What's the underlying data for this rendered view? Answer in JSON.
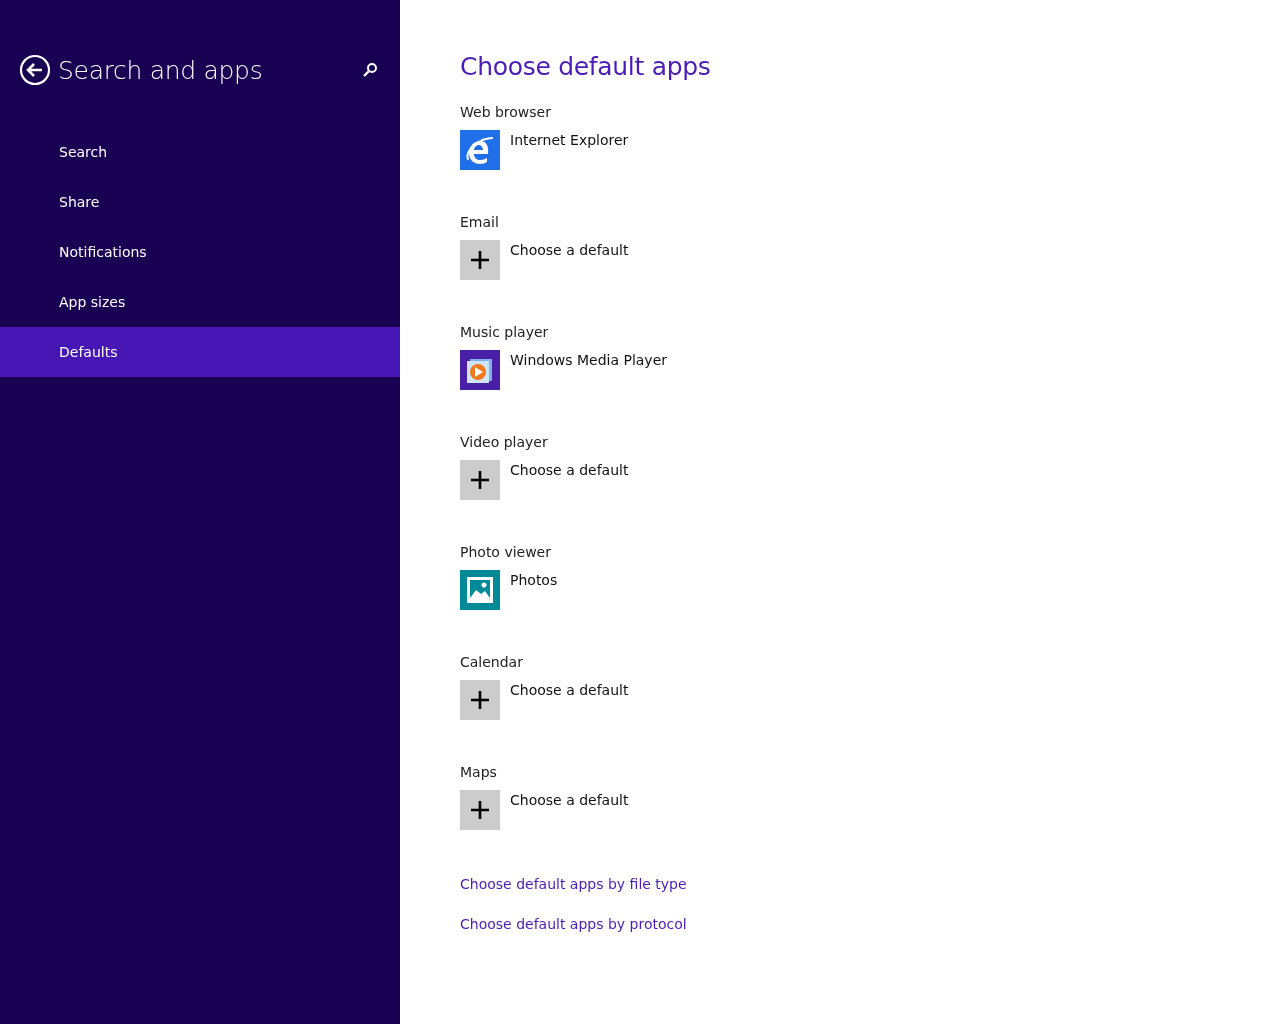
{
  "sidebar": {
    "title": "Search and apps",
    "items": [
      {
        "label": "Search",
        "selected": false
      },
      {
        "label": "Share",
        "selected": false
      },
      {
        "label": "Notifications",
        "selected": false
      },
      {
        "label": "App sizes",
        "selected": false
      },
      {
        "label": "Defaults",
        "selected": true
      }
    ]
  },
  "main": {
    "title": "Choose default apps",
    "defaults": [
      {
        "label": "Web browser",
        "app": "Internet Explorer",
        "kind": "browser"
      },
      {
        "label": "Email",
        "app": "Choose a default",
        "kind": "add"
      },
      {
        "label": "Music player",
        "app": "Windows Media Player",
        "kind": "music"
      },
      {
        "label": "Video player",
        "app": "Choose a default",
        "kind": "add"
      },
      {
        "label": "Photo viewer",
        "app": "Photos",
        "kind": "photos"
      },
      {
        "label": "Calendar",
        "app": "Choose a default",
        "kind": "add"
      },
      {
        "label": "Maps",
        "app": "Choose a default",
        "kind": "add"
      }
    ],
    "links": [
      "Choose default apps by file type",
      "Choose default apps by protocol"
    ]
  }
}
